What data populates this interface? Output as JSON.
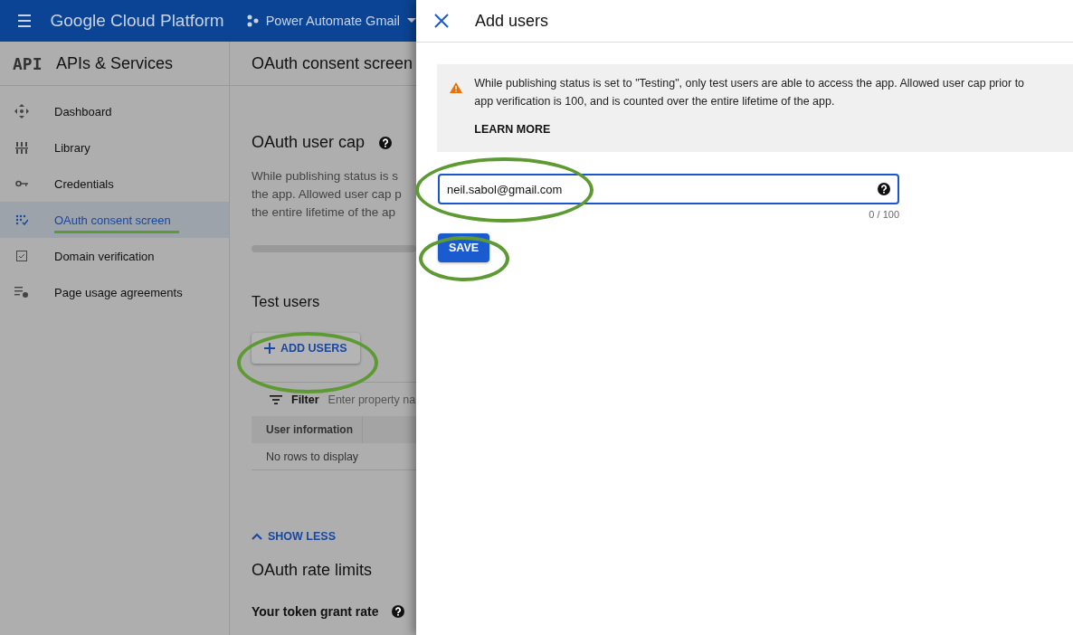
{
  "header": {
    "brand": "Google Cloud Platform",
    "project": "Power Automate Gmail"
  },
  "sidebar": {
    "title": "APIs & Services",
    "logo": "API",
    "items": [
      {
        "label": "Dashboard",
        "selected": false
      },
      {
        "label": "Library",
        "selected": false
      },
      {
        "label": "Credentials",
        "selected": false
      },
      {
        "label": "OAuth consent screen",
        "selected": true
      },
      {
        "label": "Domain verification",
        "selected": false
      },
      {
        "label": "Page usage agreements",
        "selected": false
      }
    ]
  },
  "main": {
    "title": "OAuth consent screen",
    "user_cap": {
      "heading": "OAuth user cap",
      "lines": [
        "While publishing status is s",
        "the app. Allowed user cap p",
        "the entire lifetime of the ap"
      ]
    },
    "test_users": {
      "heading": "Test users",
      "add_button": "ADD USERS",
      "filter_label": "Filter",
      "filter_placeholder": "Enter property na",
      "columns": [
        "User information"
      ],
      "empty": "No rows to display"
    },
    "show_less": "SHOW LESS",
    "rate_limits": {
      "heading": "OAuth rate limits",
      "subheading": "Your token grant rate"
    }
  },
  "panel": {
    "title": "Add users",
    "notice": "While publishing status is set to \"Testing\", only test users are able to access the app. Allowed user cap prior to app verification is 100, and is counted over the entire lifetime of the app.",
    "notice_link": "LEARN MORE",
    "email": {
      "value": "neil.sabol@gmail.com",
      "counter": "0 / 100",
      "focused": true
    },
    "save": "SAVE"
  }
}
